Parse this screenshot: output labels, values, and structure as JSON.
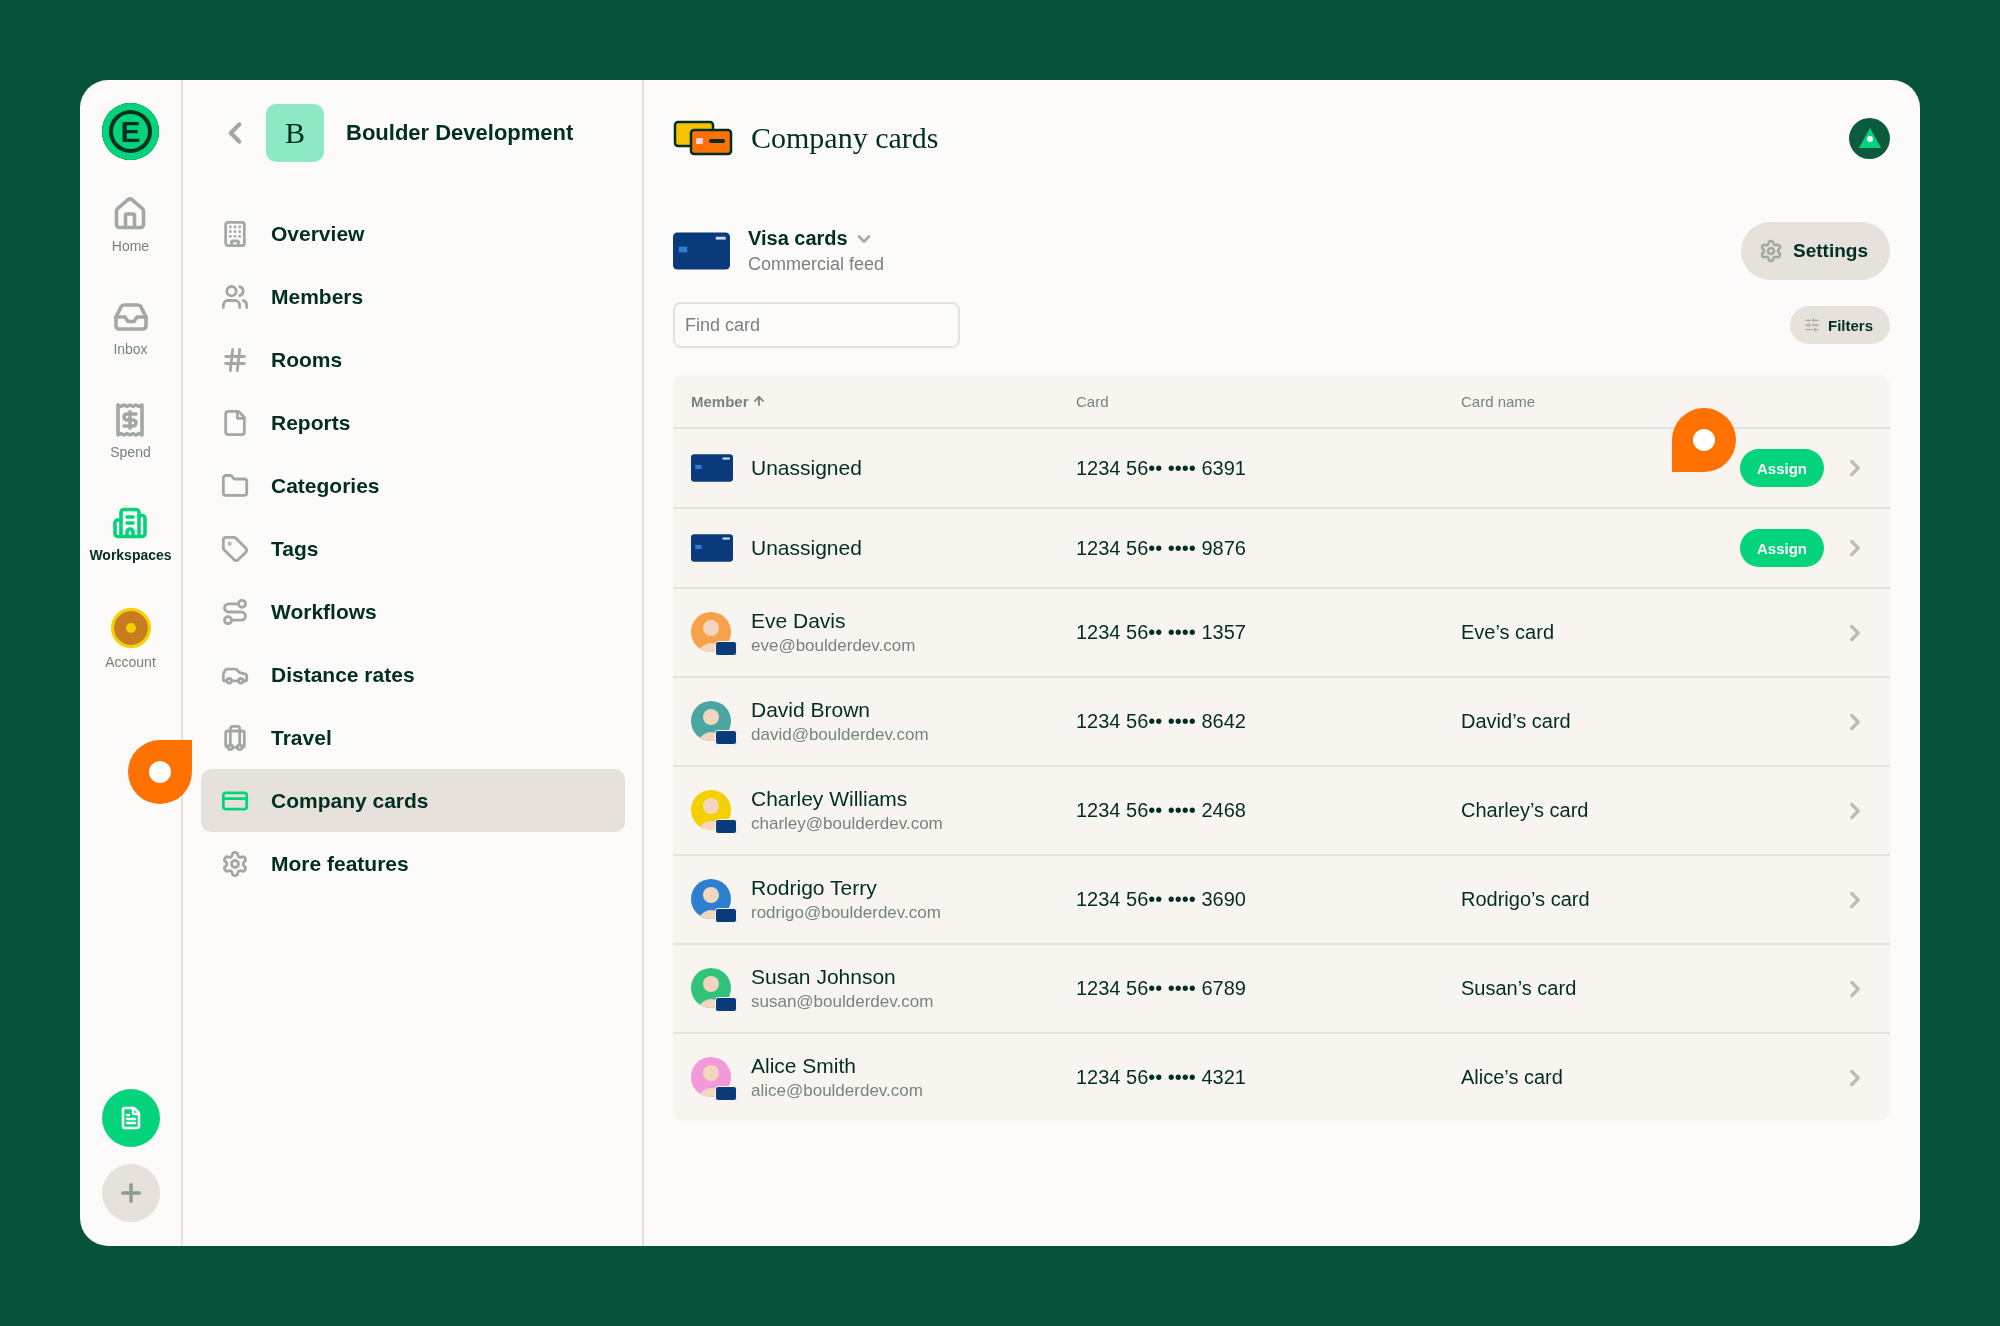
{
  "rail": {
    "logo": "E",
    "items": [
      {
        "kind": "home",
        "label": "Home",
        "selected": false
      },
      {
        "kind": "inbox",
        "label": "Inbox",
        "selected": false
      },
      {
        "kind": "spend",
        "label": "Spend",
        "selected": false
      },
      {
        "kind": "workspaces",
        "label": "Workspaces",
        "selected": true
      },
      {
        "kind": "account",
        "label": "Account",
        "selected": false
      }
    ]
  },
  "workspace": {
    "initial": "B",
    "name": "Boulder Development"
  },
  "nav": [
    {
      "label": "Overview",
      "selected": false
    },
    {
      "label": "Members",
      "selected": false
    },
    {
      "label": "Rooms",
      "selected": false
    },
    {
      "label": "Reports",
      "selected": false
    },
    {
      "label": "Categories",
      "selected": false
    },
    {
      "label": "Tags",
      "selected": false
    },
    {
      "label": "Workflows",
      "selected": false
    },
    {
      "label": "Distance rates",
      "selected": false
    },
    {
      "label": "Travel",
      "selected": false
    },
    {
      "label": "Company cards",
      "selected": true
    },
    {
      "label": "More features",
      "selected": false
    }
  ],
  "page": {
    "title": "Company cards"
  },
  "feed": {
    "name": "Visa cards",
    "subtitle": "Commercial feed"
  },
  "settings_button": "Settings",
  "search": {
    "placeholder": "Find card"
  },
  "filters_button": "Filters",
  "table": {
    "columns": [
      {
        "label": "Member",
        "sorted": true
      },
      {
        "label": "Card",
        "sorted": false
      },
      {
        "label": "Card name",
        "sorted": false
      }
    ],
    "rows": [
      {
        "kind": "unassigned",
        "name": "Unassigned",
        "card": "1234 56•• •••• 6391",
        "action": "Assign"
      },
      {
        "kind": "unassigned",
        "name": "Unassigned",
        "card": "1234 56•• •••• 9876",
        "action": "Assign"
      },
      {
        "kind": "member",
        "name": "Eve Davis",
        "email": "eve@boulderdev.com",
        "card": "1234 56•• •••• 1357",
        "card_name": "Eve’s card",
        "color": "#f7a24b"
      },
      {
        "kind": "member",
        "name": "David Brown",
        "email": "david@boulderdev.com",
        "card": "1234 56•• •••• 8642",
        "card_name": "David’s card",
        "color": "#4aa6a0"
      },
      {
        "kind": "member",
        "name": "Charley Williams",
        "email": "charley@boulderdev.com",
        "card": "1234 56•• •••• 2468",
        "card_name": "Charley’s card",
        "color": "#f5d000"
      },
      {
        "kind": "member",
        "name": "Rodrigo Terry",
        "email": "rodrigo@boulderdev.com",
        "card": "1234 56•• •••• 3690",
        "card_name": "Rodrigo’s card",
        "color": "#2f7fd0"
      },
      {
        "kind": "member",
        "name": "Susan Johnson",
        "email": "susan@boulderdev.com",
        "card": "1234 56•• •••• 6789",
        "card_name": "Susan’s card",
        "color": "#2fc47a"
      },
      {
        "kind": "member",
        "name": "Alice Smith",
        "email": "alice@boulderdev.com",
        "card": "1234 56•• •••• 4321",
        "card_name": "Alice’s card",
        "color": "#f29ad8"
      }
    ]
  }
}
